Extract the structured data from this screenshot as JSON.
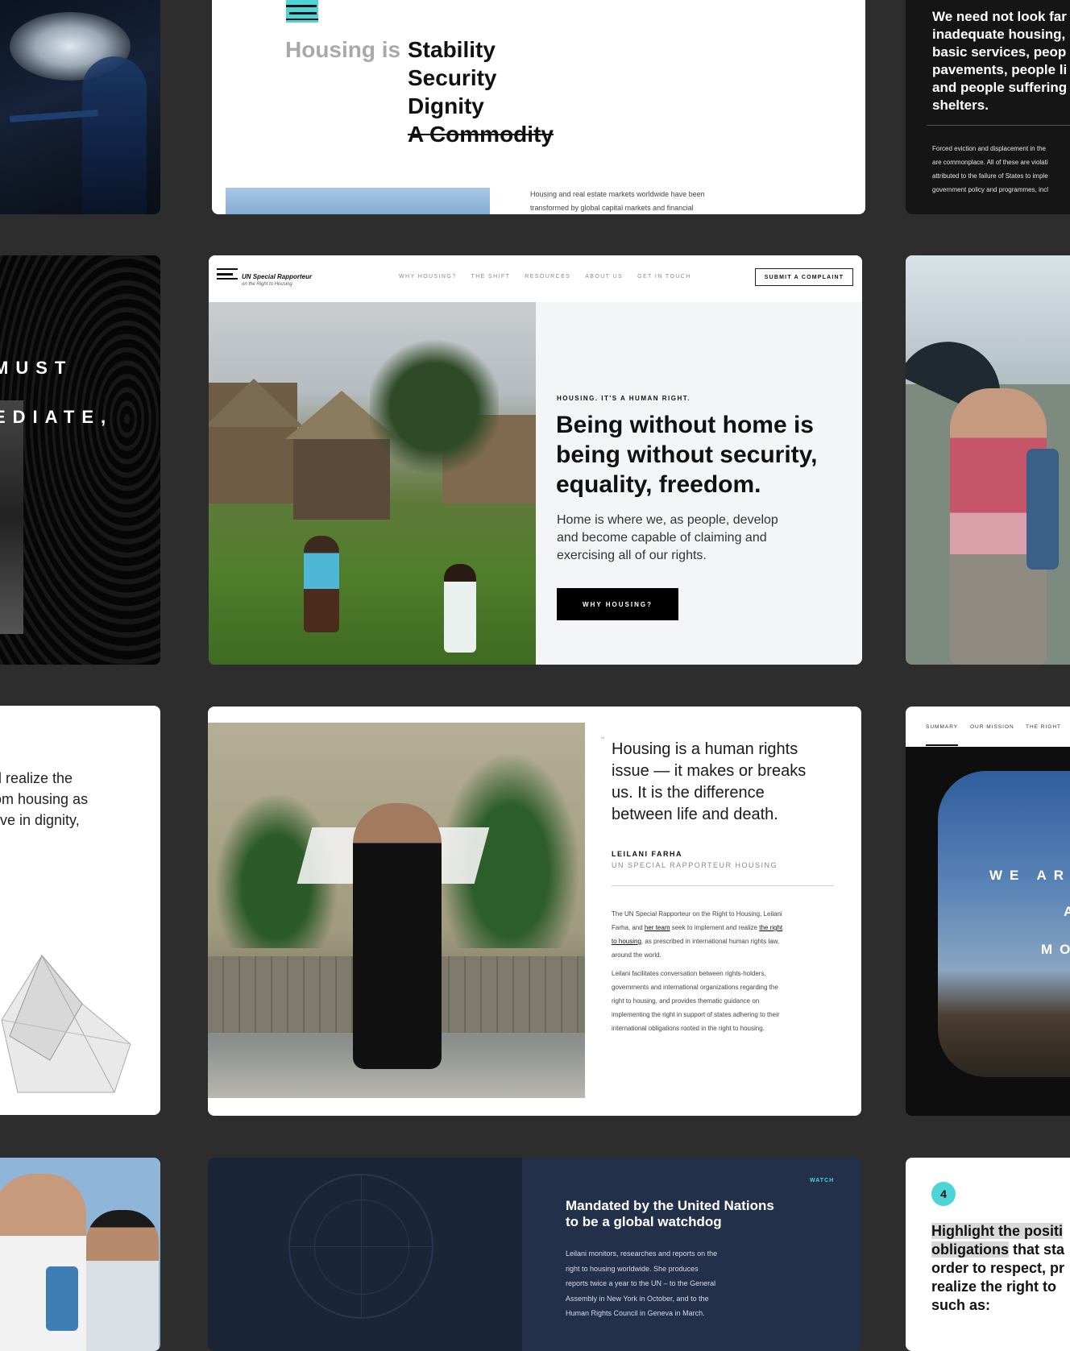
{
  "stability_card": {
    "prefix": "Housing is",
    "words": [
      "Stability",
      "Security",
      "Dignity",
      "A Commodity"
    ],
    "body_line1": "Housing and real estate markets worldwide have been",
    "body_line2": "transformed by global capital markets and financial"
  },
  "top_right_card": {
    "heading_lines": [
      "We need not look far",
      "inadequate housing,",
      "basic services, peop",
      "pavements, people li",
      "and people suffering",
      "shelters."
    ],
    "small_lines": [
      "Forced eviction and displacement in the",
      "are commonplace. All of these are violati",
      "attributed to the failure of States to imple",
      "government policy and programmes, incl"
    ]
  },
  "dark_left_card": {
    "lines": [
      "MUST",
      "EDIATE,"
    ]
  },
  "home_page": {
    "logo_title": "UN Special Rapporteur",
    "logo_subtitle": "on the Right to Housing",
    "nav": [
      "WHY HOUSING?",
      "THE SHIFT",
      "RESOURCES",
      "ABOUT US",
      "GET IN TOUCH"
    ],
    "cta": "SUBMIT A COMPLAINT",
    "eyebrow": "HOUSING. IT'S A HUMAN RIGHT.",
    "headline_lines": [
      "Being without home is",
      "being without security,",
      "equality, freedom."
    ],
    "body_lines": [
      "Home is where we, as people, develop",
      "and become capable of claiming and",
      "exercising all of our rights."
    ],
    "button": "WHY HOUSING?"
  },
  "left_text_card": {
    "lines": [
      "d realize the",
      "om housing as",
      "live in dignity,"
    ]
  },
  "quote_card": {
    "quote_lines": [
      "Housing is a human rights",
      "issue — it makes or breaks",
      "us. It is the difference",
      "between life and death."
    ],
    "name": "LEILANI FARHA",
    "role": "UN SPECIAL RAPPORTEUR HOUSING",
    "p1_a": "The UN Special Rapporteur on the Right to Housing, Leilani",
    "p1_b": "Farha, and ",
    "p1_link1": "her team",
    "p1_c": " seek to implement and realize ",
    "p1_link2": "the right",
    "p1_link3": "to housing",
    "p1_d": ", as prescribed in international human rights law,",
    "p1_e": "around the world.",
    "p2_lines": [
      "Leilani facilitates conversation between rights-holders,",
      "governments and international organizations regarding the",
      "right to housing, and provides thematic guidance on",
      "implementing the right in support of states adhering to their",
      "international obligations rooted in the right to housing."
    ]
  },
  "summary_card": {
    "tabs": [
      "SUMMARY",
      "OUR MISSION",
      "THE RIGHT"
    ],
    "big_lines": [
      "WE AR",
      "A",
      "MO"
    ]
  },
  "mandate_card": {
    "label": "WATCH",
    "title_lines": [
      "Mandated by the United Nations",
      "to be a global watchdog"
    ],
    "body_lines": [
      "Leilani monitors, researches and reports on the",
      "right to housing worldwide. She produces",
      "reports twice a year to the UN – to the General",
      "Assembly in New York in October, and to the",
      "Human Rights Council in Geneva in March."
    ]
  },
  "highlight_card": {
    "number": "4",
    "line1_hl": "Highlight the positi",
    "line2_hl": "obligations",
    "line2_rest": " that sta",
    "line3": "order to respect, pr",
    "line4": "realize the right to",
    "line5": "such as:"
  },
  "colors": {
    "background": "#2d2d2d",
    "accent_teal": "#4dd4d4",
    "navy": "#1f2a3f",
    "black": "#000000"
  }
}
